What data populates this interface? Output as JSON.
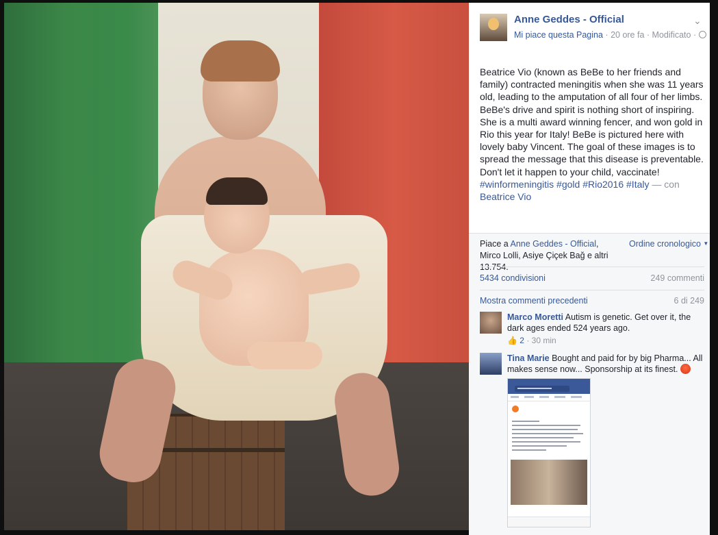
{
  "photo": {
    "alt": "photo"
  },
  "post": {
    "page_name": "Anne Geddes - Official",
    "like_page": "Mi piace questa Pagina",
    "meta_sep": " · ",
    "time": "20 ore fa",
    "edited": "Modificato",
    "description": "Beatrice Vio (known as BeBe to her friends and family) contracted meningitis when she was 11 years old, leading to the amputation of all four of her limbs. BeBe's drive and spirit is nothing short of inspiring. She is a multi award winning fencer, and won gold in Rio this year for Italy! BeBe is pictured here with lovely baby Vincent. The goal of these images is to spread the message that this disease is preventable. Don't let it happen to your child, vaccinate!",
    "hashtags": "#winformeningitis #gold #Rio2016 #Italy",
    "with_label": "— con",
    "tagged": "Beatrice Vio"
  },
  "reactions": {
    "likes_prefix": "Piace a",
    "likes_page": "Anne Geddes - Official",
    "likes_rest": ", Mirco Lolli, Asiye Çiçek Bağ e altri 13.754.",
    "order_label": "Ordine cronologico",
    "shares": "5434 condivisioni",
    "comments_count": "249 commenti"
  },
  "comments_nav": {
    "show_previous": "Mostra commenti precedenti",
    "page_info": "6 di 249"
  },
  "comments": [
    {
      "author": "Marco Moretti",
      "text": "Autism is genetic. Get over it, the dark ages ended 524 years ago.",
      "likes": "2",
      "time": "30 min"
    },
    {
      "author": "Tina Marie",
      "text": "Bought and paid for by big Pharma... All makes sense now... Sponsorship at its finest."
    }
  ]
}
